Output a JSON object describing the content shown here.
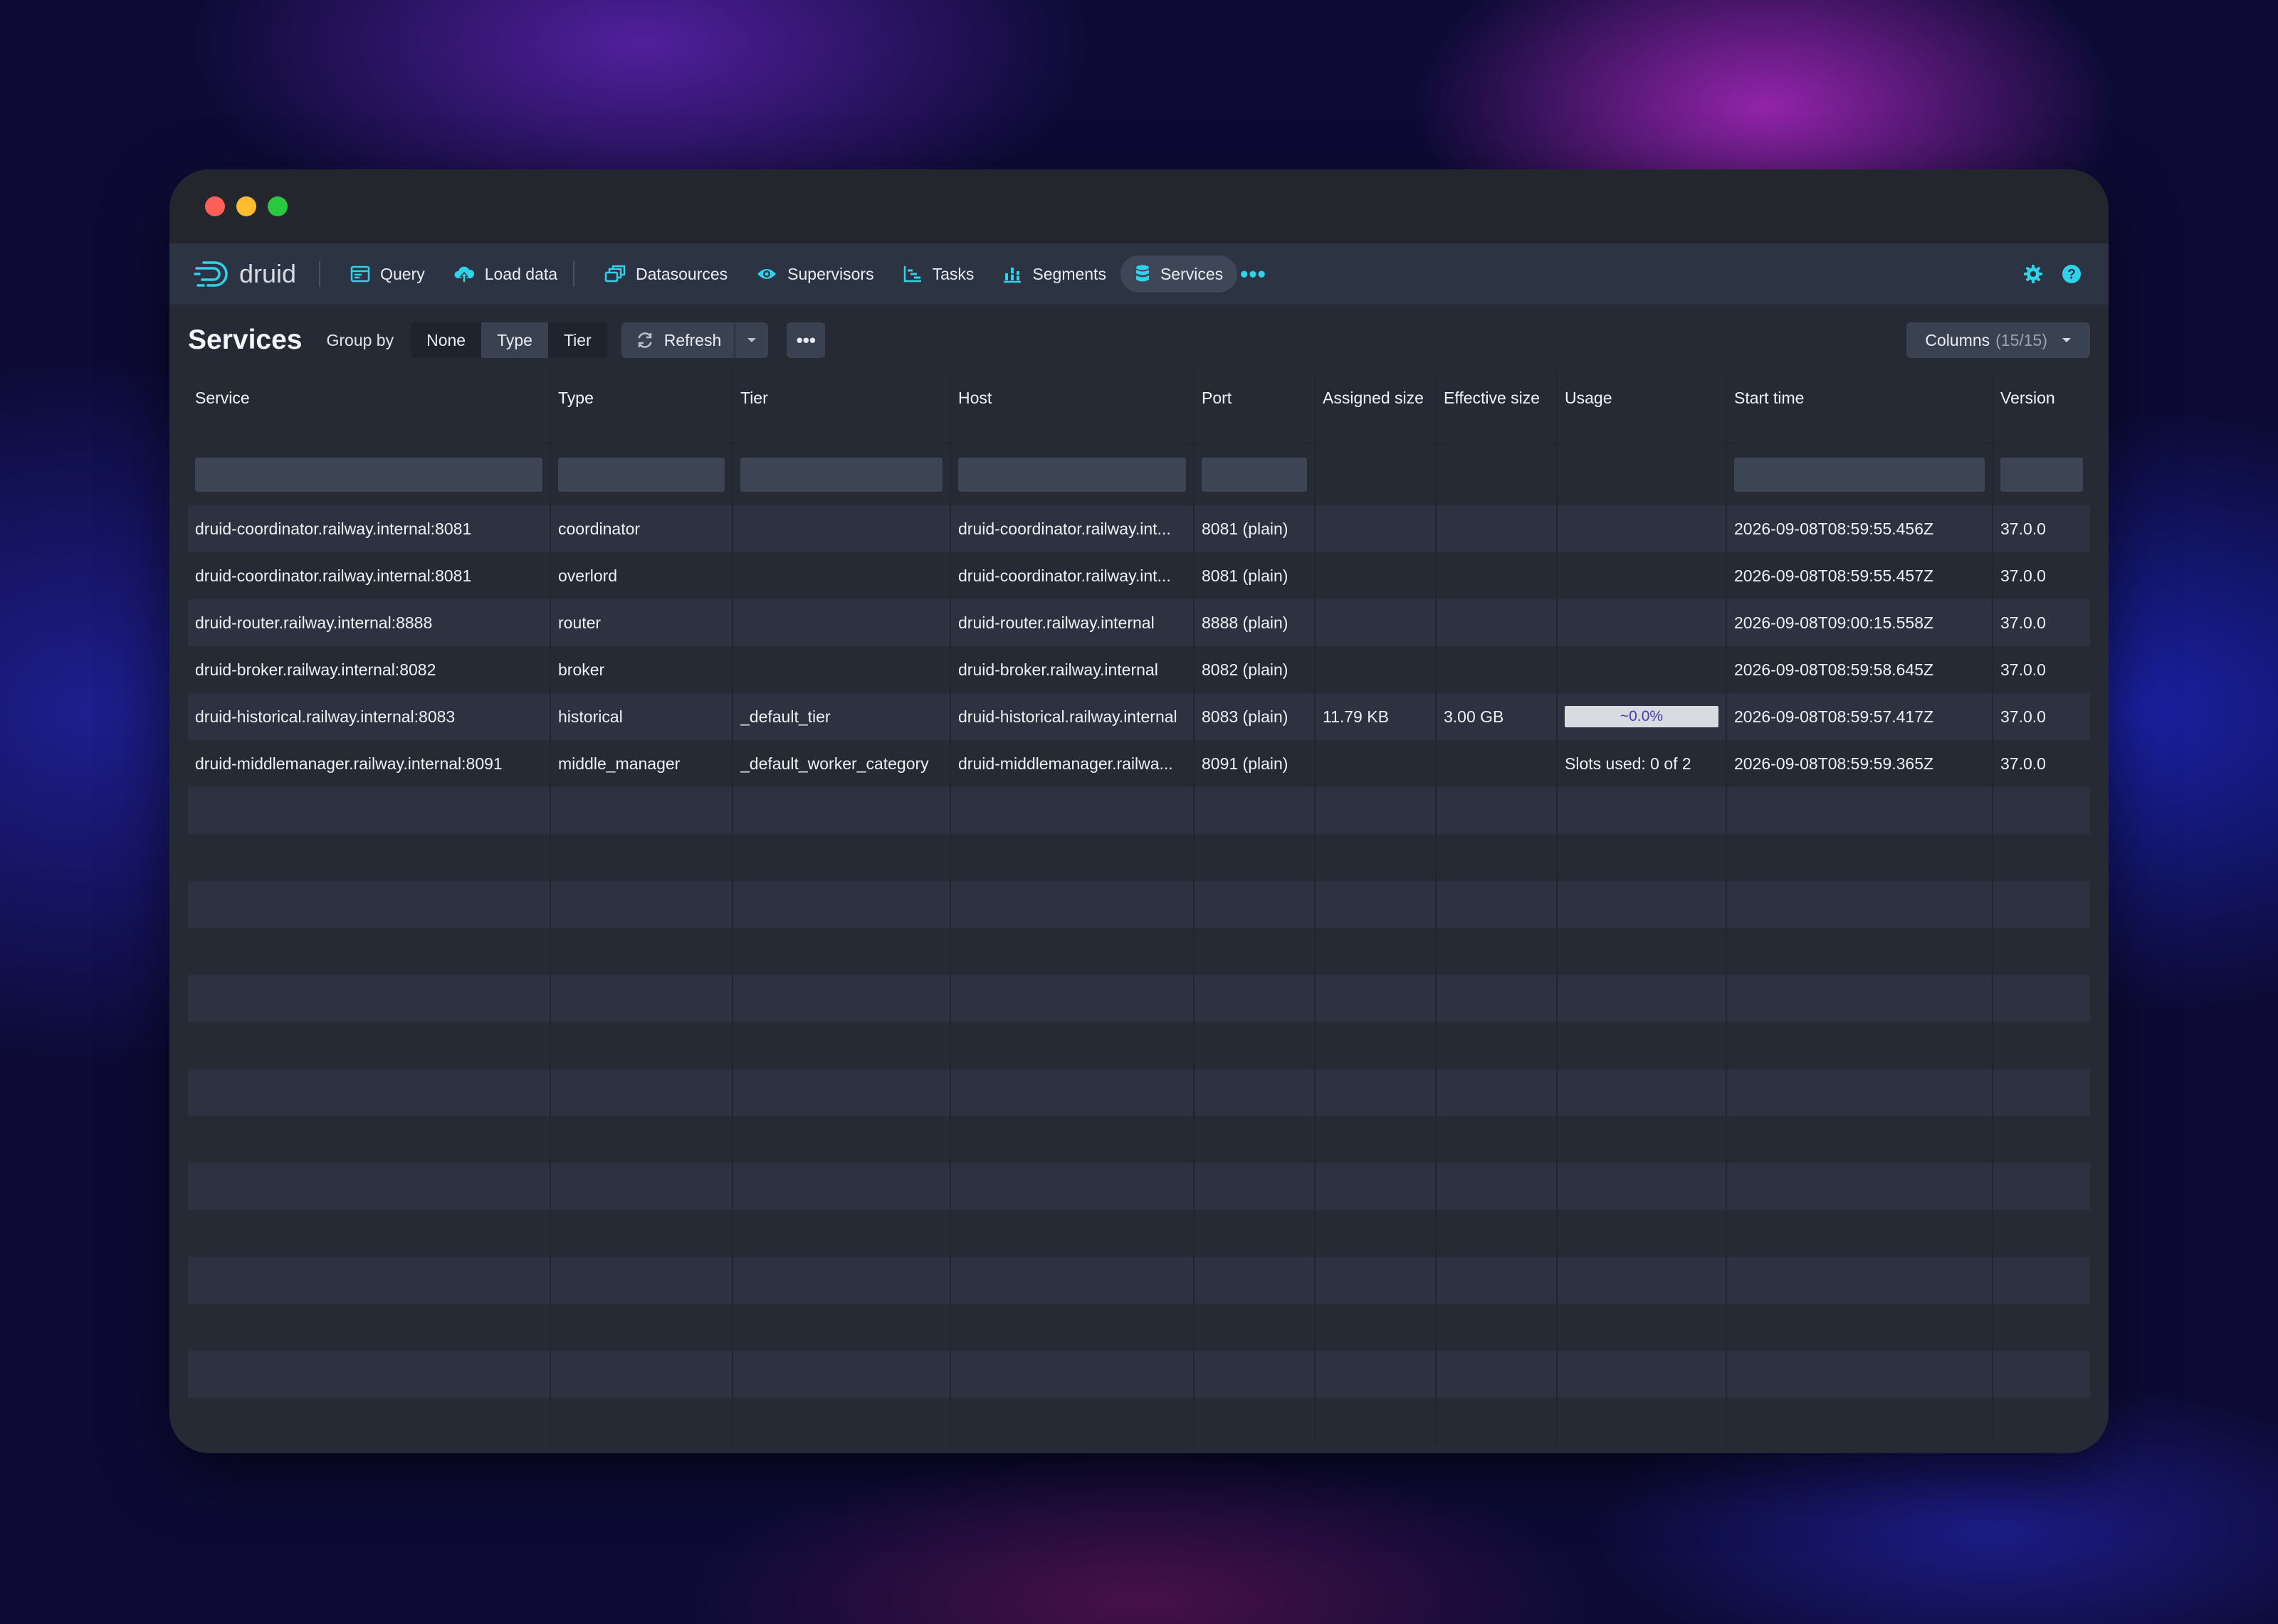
{
  "brand": {
    "logo_text": "druid"
  },
  "nav": {
    "items": [
      {
        "label": "Query",
        "icon": "query-icon"
      },
      {
        "label": "Load data",
        "icon": "cloud-upload-icon"
      },
      {
        "label": "Datasources",
        "icon": "datasources-icon"
      },
      {
        "label": "Supervisors",
        "icon": "eye-icon"
      },
      {
        "label": "Tasks",
        "icon": "gantt-chart-icon"
      },
      {
        "label": "Segments",
        "icon": "stacked-chart-icon"
      },
      {
        "label": "Services",
        "icon": "database-icon",
        "active": true
      }
    ],
    "more": "•••",
    "settings_icon": "gear-icon",
    "help_icon": "help-icon"
  },
  "toolbar": {
    "title": "Services",
    "group_by_label": "Group by",
    "group_by_options": [
      "None",
      "Type",
      "Tier"
    ],
    "group_by_selected": "Type",
    "refresh_label": "Refresh",
    "more_label": "•••",
    "columns_label": "Columns",
    "columns_count": "(15/15)"
  },
  "table": {
    "columns": [
      "Service",
      "Type",
      "Tier",
      "Host",
      "Port",
      "Assigned size",
      "Effective size",
      "Usage",
      "Start time",
      "Version"
    ],
    "rows": [
      {
        "service": "druid-coordinator.railway.internal:8081",
        "type": "coordinator",
        "tier": "",
        "host": "druid-coordinator.railway.int...",
        "port": "8081 (plain)",
        "assigned": "",
        "effective": "",
        "usage": "",
        "start": "2026-09-08T08:59:55.456Z",
        "version": "37.0.0"
      },
      {
        "service": "druid-coordinator.railway.internal:8081",
        "type": "overlord",
        "tier": "",
        "host": "druid-coordinator.railway.int...",
        "port": "8081 (plain)",
        "assigned": "",
        "effective": "",
        "usage": "",
        "start": "2026-09-08T08:59:55.457Z",
        "version": "37.0.0"
      },
      {
        "service": "druid-router.railway.internal:8888",
        "type": "router",
        "tier": "",
        "host": "druid-router.railway.internal",
        "port": "8888 (plain)",
        "assigned": "",
        "effective": "",
        "usage": "",
        "start": "2026-09-08T09:00:15.558Z",
        "version": "37.0.0"
      },
      {
        "service": "druid-broker.railway.internal:8082",
        "type": "broker",
        "tier": "",
        "host": "druid-broker.railway.internal",
        "port": "8082 (plain)",
        "assigned": "",
        "effective": "",
        "usage": "",
        "start": "2026-09-08T08:59:58.645Z",
        "version": "37.0.0"
      },
      {
        "service": "druid-historical.railway.internal:8083",
        "type": "historical",
        "tier": "_default_tier",
        "host": "druid-historical.railway.internal",
        "port": "8083 (plain)",
        "assigned": "11.79 KB",
        "effective": "3.00 GB",
        "usage": "",
        "usage_bar": "~0.0%",
        "usage_fraction": 0.0,
        "start": "2026-09-08T08:59:57.417Z",
        "version": "37.0.0"
      },
      {
        "service": "druid-middlemanager.railway.internal:8091",
        "type": "middle_manager",
        "tier": "_default_worker_category",
        "host": "druid-middlemanager.railwa...",
        "port": "8091 (plain)",
        "assigned": "",
        "effective": "",
        "usage": "Slots used: 0 of 2",
        "start": "2026-09-08T08:59:59.365Z",
        "version": "37.0.0"
      }
    ]
  },
  "colors": {
    "accent": "#2fd2e8",
    "background": "#252a35",
    "navbar": "#2c3443"
  }
}
